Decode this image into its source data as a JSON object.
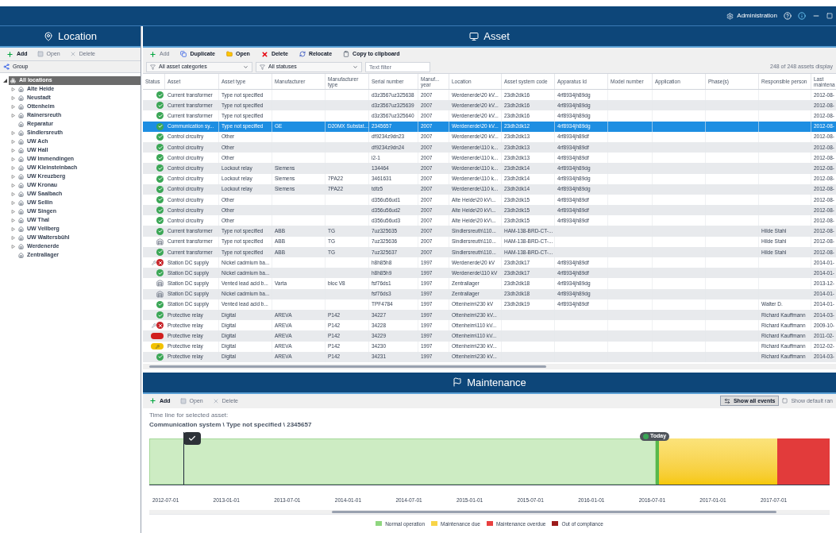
{
  "title_bar": {
    "admin": "Administration"
  },
  "location_panel": {
    "title": "Location",
    "toolbar": [
      {
        "label": "Add",
        "kind": "add",
        "disabled": false
      },
      {
        "label": "Open",
        "kind": "open",
        "disabled": true
      },
      {
        "label": "Delete",
        "kind": "delete",
        "disabled": true
      }
    ],
    "group": "Group",
    "tree": {
      "label": "All locations",
      "selected": true,
      "expanded": true,
      "children": [
        {
          "label": "Alte Heide",
          "expander": true
        },
        {
          "label": "Neustadt",
          "expander": true
        },
        {
          "label": "Ottenheim",
          "expander": true
        },
        {
          "label": "Rainersreuth",
          "expander": true
        },
        {
          "label": "Reparatur",
          "expander": false
        },
        {
          "label": "Sindlersreuth",
          "expander": true
        },
        {
          "label": "UW Ach",
          "expander": true
        },
        {
          "label": "UW Hall",
          "expander": true
        },
        {
          "label": "UW Immendingen",
          "expander": true
        },
        {
          "label": "UW Kleinsteinbach",
          "expander": true
        },
        {
          "label": "UW Kreuzberg",
          "expander": true
        },
        {
          "label": "UW Kronau",
          "expander": true
        },
        {
          "label": "UW Saalbach",
          "expander": true
        },
        {
          "label": "UW Sellin",
          "expander": true
        },
        {
          "label": "UW Singen",
          "expander": true
        },
        {
          "label": "UW Thal",
          "expander": true
        },
        {
          "label": "UW Vellberg",
          "expander": true
        },
        {
          "label": "UW Waltersbühl",
          "expander": true
        },
        {
          "label": "Werdenerde",
          "expander": true
        },
        {
          "label": "Zentrallager",
          "expander": false
        }
      ]
    }
  },
  "asset_panel": {
    "title": "Asset",
    "toolbar": [
      {
        "label": "Add",
        "kind": "add",
        "disabled": true
      },
      {
        "label": "Duplicate",
        "kind": "duplicate",
        "disabled": false
      },
      {
        "label": "Open",
        "kind": "folder",
        "disabled": false
      },
      {
        "label": "Delete",
        "kind": "remove",
        "disabled": false
      },
      {
        "label": "Relocate",
        "kind": "relocate",
        "disabled": false
      },
      {
        "label": "Copy to clipboard",
        "kind": "clipboard",
        "disabled": false
      }
    ],
    "filters": [
      "All asset categories",
      "All statuses"
    ],
    "text_filter": {
      "placeholder": "Text filter"
    },
    "count": "248 of 248 assets display",
    "table": {
      "status_header": "Status",
      "columns": [
        "Asset",
        "Asset type",
        "Manufacturer",
        "Manufacturer type",
        "Serial number",
        "Manuf... year",
        "Location",
        "Asset system code",
        "Apparatus Id",
        "Model number",
        "Application",
        "Phase(s)",
        "Responsible person",
        "Last maintena"
      ],
      "rows": [
        {
          "kind": "ok",
          "selected": false,
          "cells": [
            "Current transformer",
            "Type not specified",
            null,
            null,
            "d3z3567uz325638",
            "2007",
            "Werdenerde\\20 kV...",
            "23dh2dk16",
            "4rf8934jh89dg",
            null,
            null,
            null,
            null,
            "2012-08-"
          ]
        },
        {
          "kind": "ok",
          "selected": false,
          "cells": [
            "Current transformer",
            "Type not specified",
            null,
            null,
            "d3z3567uz325639",
            "2007",
            "Werdenerde\\20 kV...",
            "23dh2dk16",
            "4rf8934jh89dg",
            null,
            null,
            null,
            null,
            "2012-08-"
          ]
        },
        {
          "kind": "ok",
          "selected": false,
          "cells": [
            "Current transformer",
            "Type not specified",
            null,
            null,
            "d3z3567uz325640",
            "2007",
            "Werdenerde\\20 kV...",
            "23dh2dk16",
            "4rf8934jh89dg",
            null,
            null,
            null,
            null,
            "2012-08-"
          ]
        },
        {
          "kind": "ok",
          "selected": true,
          "cells": [
            "Communication sy...",
            "Type not specified",
            "GE",
            "D20MX Substat...",
            "2345657",
            "2007",
            "Werdenerde\\20 kV...",
            "23dh2dk12",
            "4rf8934jh89dg",
            null,
            null,
            null,
            null,
            "2012-08-"
          ]
        },
        {
          "kind": "ok",
          "selected": false,
          "cells": [
            "Control circuitry",
            "Other",
            null,
            null,
            "df9234z9dn23",
            "2007",
            "Werdenerde\\20 kV...",
            "23dh2dk13",
            "4rf8934jh89df",
            null,
            null,
            null,
            null,
            "2012-08-"
          ]
        },
        {
          "kind": "ok",
          "selected": false,
          "cells": [
            "Control circuitry",
            "Other",
            null,
            null,
            "df9234z9dn24",
            "2007",
            "Werdenerde\\110 k...",
            "23dh2dk13",
            "4rf8934jh89df",
            null,
            null,
            null,
            null,
            "2012-08-"
          ]
        },
        {
          "kind": "ok",
          "selected": false,
          "cells": [
            "Control circuitry",
            "Other",
            null,
            null,
            "i2-1",
            "2007",
            "Werdenerde\\110 k...",
            "23dh2dk13",
            "4rf8934jh89df",
            null,
            null,
            null,
            null,
            "2012-08-"
          ]
        },
        {
          "kind": "ok",
          "selected": false,
          "cells": [
            "Control circuitry",
            "Lockout relay",
            "Siemens",
            null,
            "134464",
            "2007",
            "Werdenerde\\110 k...",
            "23dh2dk14",
            "4rf8934jh89dg",
            null,
            null,
            null,
            null,
            "2012-08-"
          ]
        },
        {
          "kind": "ok",
          "selected": false,
          "cells": [
            "Control circuitry",
            "Lockout relay",
            "Siemens",
            "7PA22",
            "3461631",
            "2007",
            "Werdenerde\\110 k...",
            "23dh2dk14",
            "4rf8934jh89dg",
            null,
            null,
            null,
            null,
            "2012-08-"
          ]
        },
        {
          "kind": "ok",
          "selected": false,
          "cells": [
            "Control circuitry",
            "Lockout relay",
            "Siemens",
            "7PA22",
            "tdfz5",
            "2007",
            "Werdenerde\\110 k...",
            "23dh2dk14",
            "4rf8934jh89dg",
            null,
            null,
            null,
            null,
            "2012-08-"
          ]
        },
        {
          "kind": "ok",
          "selected": false,
          "cells": [
            "Control circuitry",
            "Other",
            null,
            null,
            "d356u56ud1",
            "2007",
            "Alte Heide\\20 kV\\...",
            "23dh2dk15",
            "4rf8934jh89df",
            null,
            null,
            null,
            null,
            "2012-08-"
          ]
        },
        {
          "kind": "ok",
          "selected": false,
          "cells": [
            "Control circuitry",
            "Other",
            null,
            null,
            "d356u56ud2",
            "2007",
            "Alte Heide\\20 kV\\...",
            "23dh2dk15",
            "4rf8934jh89df",
            null,
            null,
            null,
            null,
            "2012-08-"
          ]
        },
        {
          "kind": "ok",
          "selected": false,
          "cells": [
            "Control circuitry",
            "Other",
            null,
            null,
            "d356u56ud3",
            "2007",
            "Alte Heide\\20 kV\\...",
            "23dh2dk15",
            "4rf8934jh89df",
            null,
            null,
            null,
            null,
            "2012-08-"
          ]
        },
        {
          "kind": "ok",
          "selected": false,
          "cells": [
            "Current transformer",
            "Type not specified",
            "ABB",
            "TG",
            "7uz325635",
            "2007",
            "Sindlersreuth\\110...",
            "HAM-138-BRD-CT-...",
            null,
            null,
            null,
            null,
            "Hilde Stahl",
            "2012-08-"
          ]
        },
        {
          "kind": "storage",
          "selected": false,
          "cells": [
            "Current transformer",
            "Type not specified",
            "ABB",
            "TG",
            "7uz325636",
            "2007",
            "Sindlersreuth\\110...",
            "HAM-138-BRD-CT-...",
            null,
            null,
            null,
            null,
            "Hilde Stahl",
            "2012-08-"
          ]
        },
        {
          "kind": "ok",
          "selected": false,
          "cells": [
            "Current transformer",
            "Type not specified",
            "ABB",
            "TG",
            "7uz325637",
            "2007",
            "Sindlersreuth\\110...",
            "HAM-138-BRD-CT-...",
            null,
            null,
            null,
            null,
            "Hilde Stahl",
            "2012-08-"
          ]
        },
        {
          "kind": "fault",
          "selected": false,
          "cells": [
            "Station DC supply",
            "Nickel cadmium ba...",
            null,
            null,
            "h8h85h8",
            "1997",
            "Werdenerde\\20 kV",
            "23dh2dk17",
            "4rf8934jh89df",
            null,
            null,
            null,
            null,
            "2014-01-"
          ]
        },
        {
          "kind": "ok",
          "selected": false,
          "cells": [
            "Station DC supply",
            "Nickel cadmium ba...",
            null,
            null,
            "h8h85h9",
            "1997",
            "Werdenerde\\110 kV",
            "23dh2dk17",
            "4rf8934jh89df",
            null,
            null,
            null,
            null,
            "2014-01-"
          ]
        },
        {
          "kind": "storage",
          "selected": false,
          "cells": [
            "Station DC supply",
            "Vented lead acid b...",
            "Varta",
            "bloc V8",
            "fsf76ds1",
            "1997",
            "Zentrallager",
            "23dh2dk18",
            "4rf8934jh89dg",
            null,
            null,
            null,
            null,
            "2013-12-"
          ]
        },
        {
          "kind": "storage",
          "selected": false,
          "cells": [
            "Station DC supply",
            "Nickel cadmium ba...",
            null,
            null,
            "fsf76ds3",
            "1997",
            "Zentrallager",
            "23dh2dk18",
            "4rf8934jh89dg",
            null,
            null,
            null,
            null,
            "2014-01-"
          ]
        },
        {
          "kind": "ok",
          "selected": false,
          "cells": [
            "Station DC supply",
            "Vented lead acid b...",
            null,
            null,
            "TPF4784",
            "1997",
            "Ottenheim\\230 kV",
            "23dh2dk19",
            "4rf8934jh89df",
            null,
            null,
            null,
            "Walter D.",
            "2014-01-"
          ]
        },
        {
          "kind": "ok",
          "selected": false,
          "cells": [
            "Protective relay",
            "Digital",
            "AREVA",
            "P142",
            "34227",
            "1997",
            "Ottenheim\\230 kV...",
            null,
            null,
            null,
            null,
            null,
            "Richard Kauffmann",
            "2014-03-"
          ]
        },
        {
          "kind": "fault",
          "selected": false,
          "cells": [
            "Protective relay",
            "Digital",
            "AREVA",
            "P142",
            "34228",
            "1997",
            "Ottenheim\\110 kV...",
            null,
            null,
            null,
            null,
            null,
            "Richard Kauffmann",
            "2009-10-"
          ]
        },
        {
          "kind": "critical",
          "selected": false,
          "cells": [
            "Protective relay",
            "Digital",
            "AREVA",
            "P142",
            "34229",
            "1997",
            "Ottenheim\\110 kV...",
            null,
            null,
            null,
            null,
            null,
            "Richard Kauffmann",
            "2011-02-"
          ]
        },
        {
          "kind": "warning",
          "selected": false,
          "cells": [
            "Protective relay",
            "Digital",
            "AREVA",
            "P142",
            "34230",
            "1997",
            "Ottenheim\\230 kV...",
            null,
            null,
            null,
            null,
            null,
            "Richard Kauffmann",
            "2012-02-"
          ]
        },
        {
          "kind": "ok",
          "selected": false,
          "cells": [
            "Protective relay",
            "Digital",
            "AREVA",
            "P142",
            "34231",
            "1997",
            "Ottenheim\\230 kV...",
            null,
            null,
            null,
            null,
            null,
            "Richard Kauffmann",
            "2014-03-"
          ]
        }
      ]
    }
  },
  "maintenance_panel": {
    "title": "Maintenance",
    "toolbar": [
      {
        "label": "Add",
        "kind": "add",
        "disabled": false
      },
      {
        "label": "Open",
        "kind": "open",
        "disabled": true
      },
      {
        "label": "Delete",
        "kind": "delete",
        "disabled": true
      }
    ],
    "show_all_events": {
      "label": "Show all events",
      "on": true
    },
    "show_default": {
      "label": "Show default ran",
      "disabled": true
    },
    "caption": "Time line for selected asset:",
    "asset_path": "Communication system \\ Type not specified \\ 2345657",
    "today": "Today",
    "ticks": [
      "2012-07-01",
      "2013-01-01",
      "2013-07-01",
      "2014-01-01",
      "2014-07-01",
      "2015-01-01",
      "2015-07-01",
      "2016-01-01",
      "2016-07-01",
      "2017-01-01",
      "2017-07-01"
    ],
    "legend": [
      {
        "label": "Normal operation",
        "color": "#8fd67f"
      },
      {
        "label": "Maintenance due",
        "color": "#f8d447"
      },
      {
        "label": "Maintenance overdue",
        "color": "#e8403f"
      },
      {
        "label": "Out of compliance",
        "color": "#9c1b1b"
      }
    ]
  }
}
